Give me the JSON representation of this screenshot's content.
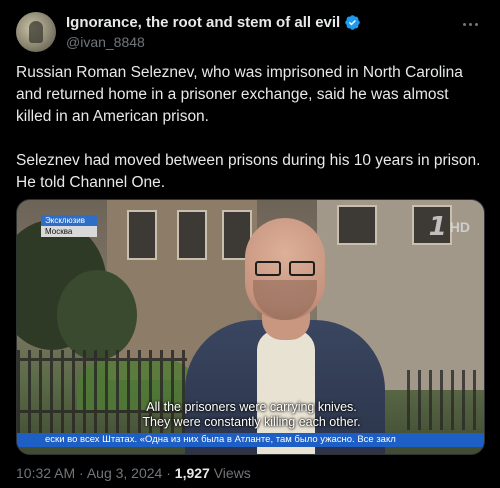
{
  "tweet": {
    "author": {
      "display_name": "Ignorance, the root and stem of all evil",
      "handle": "@ivan_8848",
      "verified_icon": "verified-badge-icon",
      "accent_color": "#1d9bf0"
    },
    "more_icon": "more-options-icon",
    "body": [
      "Russian Roman Seleznev, who was imprisoned in North Carolina and returned home in a prisoner exchange, said he was almost killed in an American prison.",
      "Seleznev had moved between prisons during his 10 years in prison. He told Channel One."
    ],
    "media": {
      "channel_logo": "1",
      "channel_logo_suffix": "HD",
      "chyron_top": "Эксклюзив",
      "chyron_bottom": "Москва",
      "subtitle_line1": "All the prisoners were carrying knives.",
      "subtitle_line2": "They were constantly killing each other.",
      "ticker": "ески во всех Штатах.   «Одна из них была в Атланте, там было ужасно.   Все закл"
    },
    "timestamp": "10:32 AM · Aug 3, 2024 · ",
    "views_count": "1,927",
    "views_label": " Views"
  }
}
